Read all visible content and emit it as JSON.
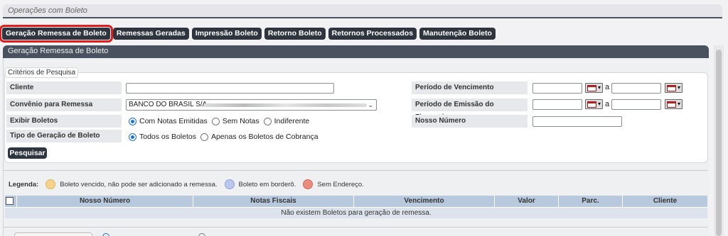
{
  "header": {
    "title": "Operações com Boleto"
  },
  "tabs": [
    {
      "label": "Geração Remessa de Boleto",
      "active": true
    },
    {
      "label": "Remessas Geradas"
    },
    {
      "label": "Impressão Boleto"
    },
    {
      "label": "Retorno Boleto"
    },
    {
      "label": "Retornos Processados"
    },
    {
      "label": "Manutenção Boleto"
    }
  ],
  "section": {
    "title": "Geração Remessa de Boleto"
  },
  "criteria": {
    "legend": "Critérios de Pesquisa",
    "cliente_label": "Cliente",
    "cliente_value": "",
    "convenio_label": "Convênio para Remessa",
    "convenio_value": "BANCO DO BRASIL S/A",
    "exibir_label": "Exibir Boletos",
    "exibir_options": [
      "Com Notas Emitidas",
      "Sem Notas",
      "Indiferente"
    ],
    "exibir_selected": "Com Notas Emitidas",
    "tipo_label": "Tipo de Geração de Boleto",
    "tipo_options": [
      "Todos os Boletos",
      "Apenas os Boletos de Cobrança"
    ],
    "tipo_selected": "Todos os Boletos",
    "vencimento_label": "Período de Vencimento",
    "emissao_label": "Período de Emissão do Financeiro",
    "nosso_numero_label": "Nosso Número",
    "range_sep": "a",
    "search_button": "Pesquisar"
  },
  "legend": {
    "label": "Legenda:",
    "items": [
      {
        "text": "Boleto vencido, não pode ser adicionado a remessa.",
        "color": "#f6d28a"
      },
      {
        "text": "Boleto em borderô.",
        "color": "#b9c6ee"
      },
      {
        "text": "Sem Endereço.",
        "color": "#ec8c7e"
      }
    ]
  },
  "table": {
    "columns": [
      "Nosso Número",
      "Notas Fiscais",
      "Vencimento",
      "Valor",
      "Parc.",
      "Cliente"
    ],
    "empty_message": "Não existem Boletos para geração de remessa."
  },
  "colors": {
    "tab_bg": "#2e353e",
    "active_outline": "#e01b1b",
    "header_bg": "#4a5260",
    "table_header": "#b8c8dd"
  }
}
